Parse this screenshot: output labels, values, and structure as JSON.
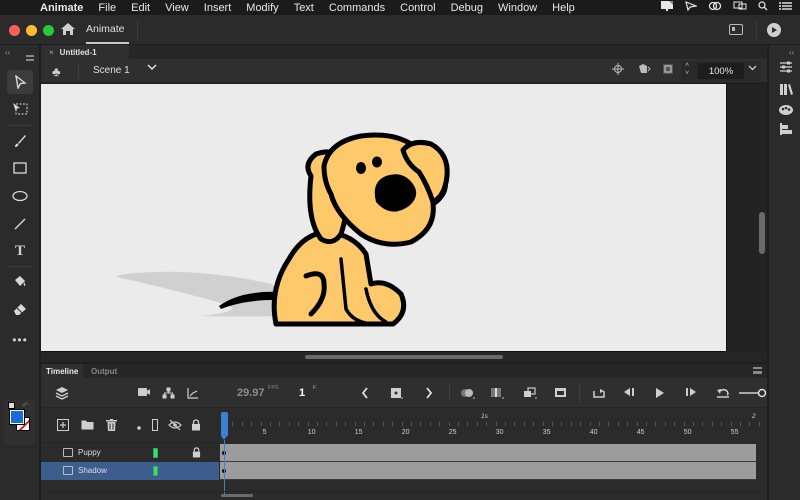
{
  "menubar": {
    "apple": "",
    "items": [
      "Animate",
      "File",
      "Edit",
      "View",
      "Insert",
      "Modify",
      "Text",
      "Commands",
      "Control",
      "Debug",
      "Window",
      "Help"
    ],
    "status_icons": [
      "notification-icon",
      "send-icon",
      "creative-cloud-icon",
      "display-mirror-icon",
      "spotlight-search-icon",
      "control-center-icon"
    ]
  },
  "titlebar": {
    "app_tab": "Animate",
    "traffic_colors": {
      "close": "#fe5f57",
      "minimize": "#febc2e",
      "maximize": "#28c840"
    }
  },
  "document": {
    "tab_close": "×",
    "tab_title": "Untitled-1",
    "scene_name": "Scene 1",
    "zoom_value": "100%"
  },
  "tools": [
    "selection",
    "free-transform",
    "brush",
    "rectangle",
    "oval",
    "line",
    "text",
    "paint-bucket",
    "eraser",
    "more"
  ],
  "colors": {
    "fill": "#1a6ad8",
    "stroke": "#ffffff",
    "dog_body": "#fdc96a",
    "outline": "#000000",
    "stage": "#ebebeb",
    "selection_row": "#3b5e8f",
    "playhead": "#3b80d6",
    "layer_outline": "#4cdc4c"
  },
  "timeline": {
    "tabs": [
      "Timeline",
      "Output"
    ],
    "fps": "29.97",
    "fps_label": "FPS",
    "frame": "1",
    "frame_label": "F",
    "ruler_numbers": [
      "5",
      "10",
      "15",
      "20",
      "25",
      "30",
      "35",
      "40",
      "45",
      "50",
      "55"
    ],
    "ruler_seconds": [
      "1s",
      "2"
    ],
    "layers": [
      {
        "name": "Puppy",
        "locked": true,
        "selected": false
      },
      {
        "name": "Shadow",
        "locked": false,
        "selected": true
      }
    ],
    "frame_count": 57
  }
}
